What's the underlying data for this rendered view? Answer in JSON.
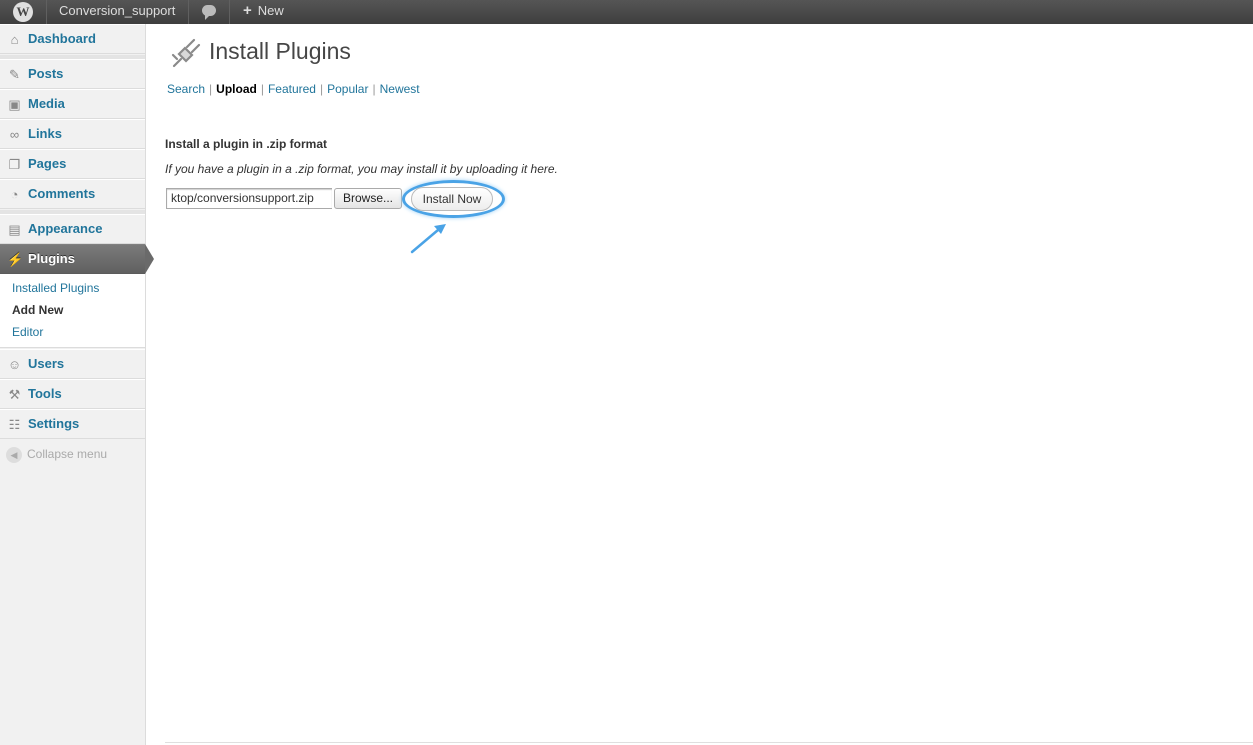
{
  "adminbar": {
    "site_name": "Conversion_support",
    "new_label": "New",
    "new_icon": "plus-icon",
    "comments_icon": "speech-bubble-icon"
  },
  "sidebar": {
    "items": [
      {
        "label": "Dashboard",
        "icon": "home-icon"
      },
      {
        "label": "Posts",
        "icon": "pin-icon"
      },
      {
        "label": "Media",
        "icon": "media-icon"
      },
      {
        "label": "Links",
        "icon": "chain-icon"
      },
      {
        "label": "Pages",
        "icon": "pages-icon"
      },
      {
        "label": "Comments",
        "icon": "comment-icon"
      },
      {
        "label": "Appearance",
        "icon": "appearance-icon"
      },
      {
        "label": "Plugins",
        "icon": "plug-icon"
      },
      {
        "label": "Users",
        "icon": "users-icon"
      },
      {
        "label": "Tools",
        "icon": "tools-icon"
      },
      {
        "label": "Settings",
        "icon": "settings-icon"
      }
    ],
    "submenu": [
      {
        "label": "Installed Plugins"
      },
      {
        "label": "Add New"
      },
      {
        "label": "Editor"
      }
    ],
    "collapse_label": "Collapse menu"
  },
  "main": {
    "title": "Install Plugins",
    "tabs": [
      {
        "label": "Search"
      },
      {
        "label": "Upload"
      },
      {
        "label": "Featured"
      },
      {
        "label": "Popular"
      },
      {
        "label": "Newest"
      }
    ],
    "separator": "|",
    "section_heading": "Install a plugin in .zip format",
    "description": "If you have a plugin in a .zip format, you may install it by uploading it here.",
    "file_value": "ktop/conversionsupport.zip",
    "browse_label": "Browse...",
    "install_label": "Install Now"
  },
  "colors": {
    "link": "#21759b",
    "highlight": "#4aa3e6",
    "adminbar": "#464646"
  }
}
